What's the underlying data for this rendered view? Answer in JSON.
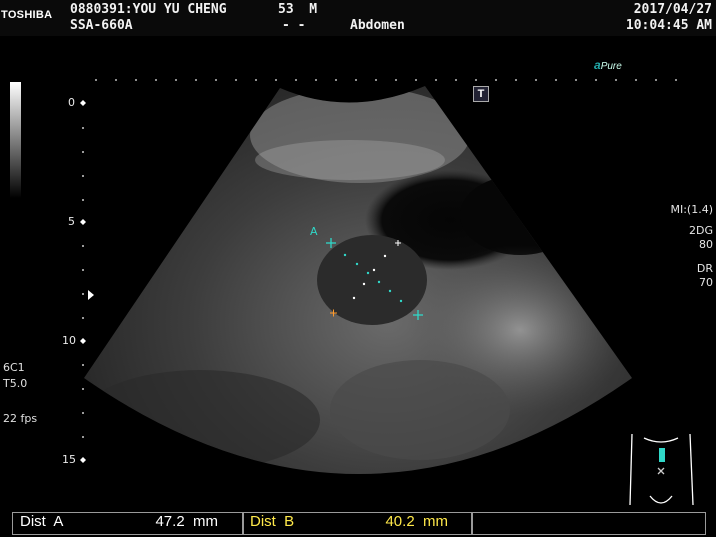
{
  "header": {
    "brand": "TOSHIBA",
    "patient": "0880391:YOU YU CHENG",
    "age_sex": "53  M",
    "system": "SSA-660A",
    "dashes": "- -",
    "exam": "Abdomen",
    "date": "2017/04/27",
    "time": "10:04:45 AM"
  },
  "logo": {
    "apure": "Pure",
    "t_icon": "T"
  },
  "depth_scale": {
    "d0": "0",
    "d5": "5",
    "d10": "10",
    "d15": "15"
  },
  "left_panel": {
    "probe": "6C1",
    "preset": "T5.0",
    "fps": "22 fps"
  },
  "right_panel": {
    "mi": "MI:(1.4)",
    "mode": "2DG",
    "gain": "80",
    "dr_label": "DR",
    "dr_value": "70"
  },
  "caliper_labels": {
    "a": "A"
  },
  "measurements": {
    "a_label": "Dist  A",
    "a_value": "47.2  mm",
    "b_label": "Dist  B",
    "b_value": "40.2  mm"
  },
  "colors": {
    "dist_a": "#ffffff",
    "dist_b": "#ffe94a",
    "caliper_a": "#30d8c8",
    "caliper_b": "#ff9a2a"
  }
}
